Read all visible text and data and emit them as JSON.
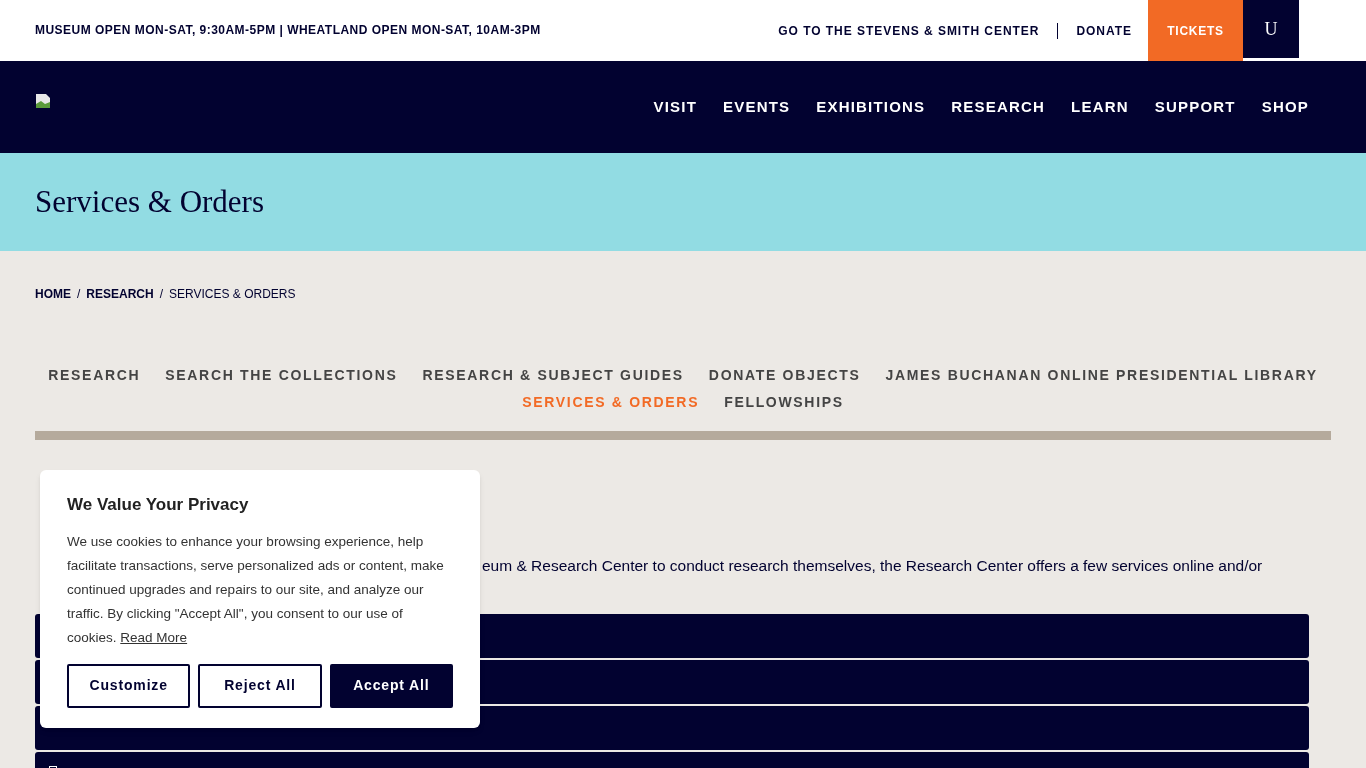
{
  "top_bar": {
    "hours": "MUSEUM OPEN MON-SAT, 9:30AM-5PM | WHEATLAND OPEN MON-SAT, 10AM-3PM",
    "links": [
      "GO TO THE STEVENS & SMITH CENTER",
      "DONATE"
    ],
    "tickets": "TICKETS",
    "user_button": "U"
  },
  "main_nav": [
    "VISIT",
    "EVENTS",
    "EXHIBITIONS",
    "RESEARCH",
    "LEARN",
    "SUPPORT",
    "SHOP"
  ],
  "page_title": "Services & Orders",
  "breadcrumb": [
    {
      "label": "HOME",
      "link": true
    },
    {
      "label": "/",
      "link": false
    },
    {
      "label": "RESEARCH",
      "link": true
    },
    {
      "label": "/",
      "link": false
    },
    {
      "label": "SERVICES & ORDERS",
      "link": false
    }
  ],
  "sub_nav": [
    {
      "label": "RESEARCH",
      "selected": false
    },
    {
      "label": "SEARCH THE COLLECTIONS",
      "selected": false
    },
    {
      "label": "RESEARCH & SUBJECT GUIDES",
      "selected": false
    },
    {
      "label": "DONATE OBJECTS",
      "selected": false
    },
    {
      "label": "JAMES BUCHANAN ONLINE PRESIDENTIAL LIBRARY",
      "selected": false
    },
    {
      "label": "SERVICES & ORDERS",
      "selected": true
    },
    {
      "label": "FELLOWSHIPS",
      "selected": false
    }
  ],
  "intro_text": "eum & Research Center to conduct research themselves, the Research Center offers a few services online and/or",
  "accordion": [
    {
      "kind": "plain"
    },
    {
      "kind": "plain"
    },
    {
      "kind": "collapsed"
    },
    {
      "kind": "collapsed"
    }
  ],
  "cookie_dialog": {
    "title": "We Value Your Privacy",
    "body": "We use cookies to enhance your browsing experience, help facilitate transactions, serve personalized ads or content, make continued upgrades and repairs to our site, and analyze our traffic. By clicking \"Accept All\", you consent to our use of cookies.",
    "link": "Read More",
    "buttons": [
      {
        "label": "Customize",
        "kind": "outline"
      },
      {
        "label": "Reject All",
        "kind": "outline"
      },
      {
        "label": "Accept All",
        "kind": "solid"
      }
    ]
  }
}
